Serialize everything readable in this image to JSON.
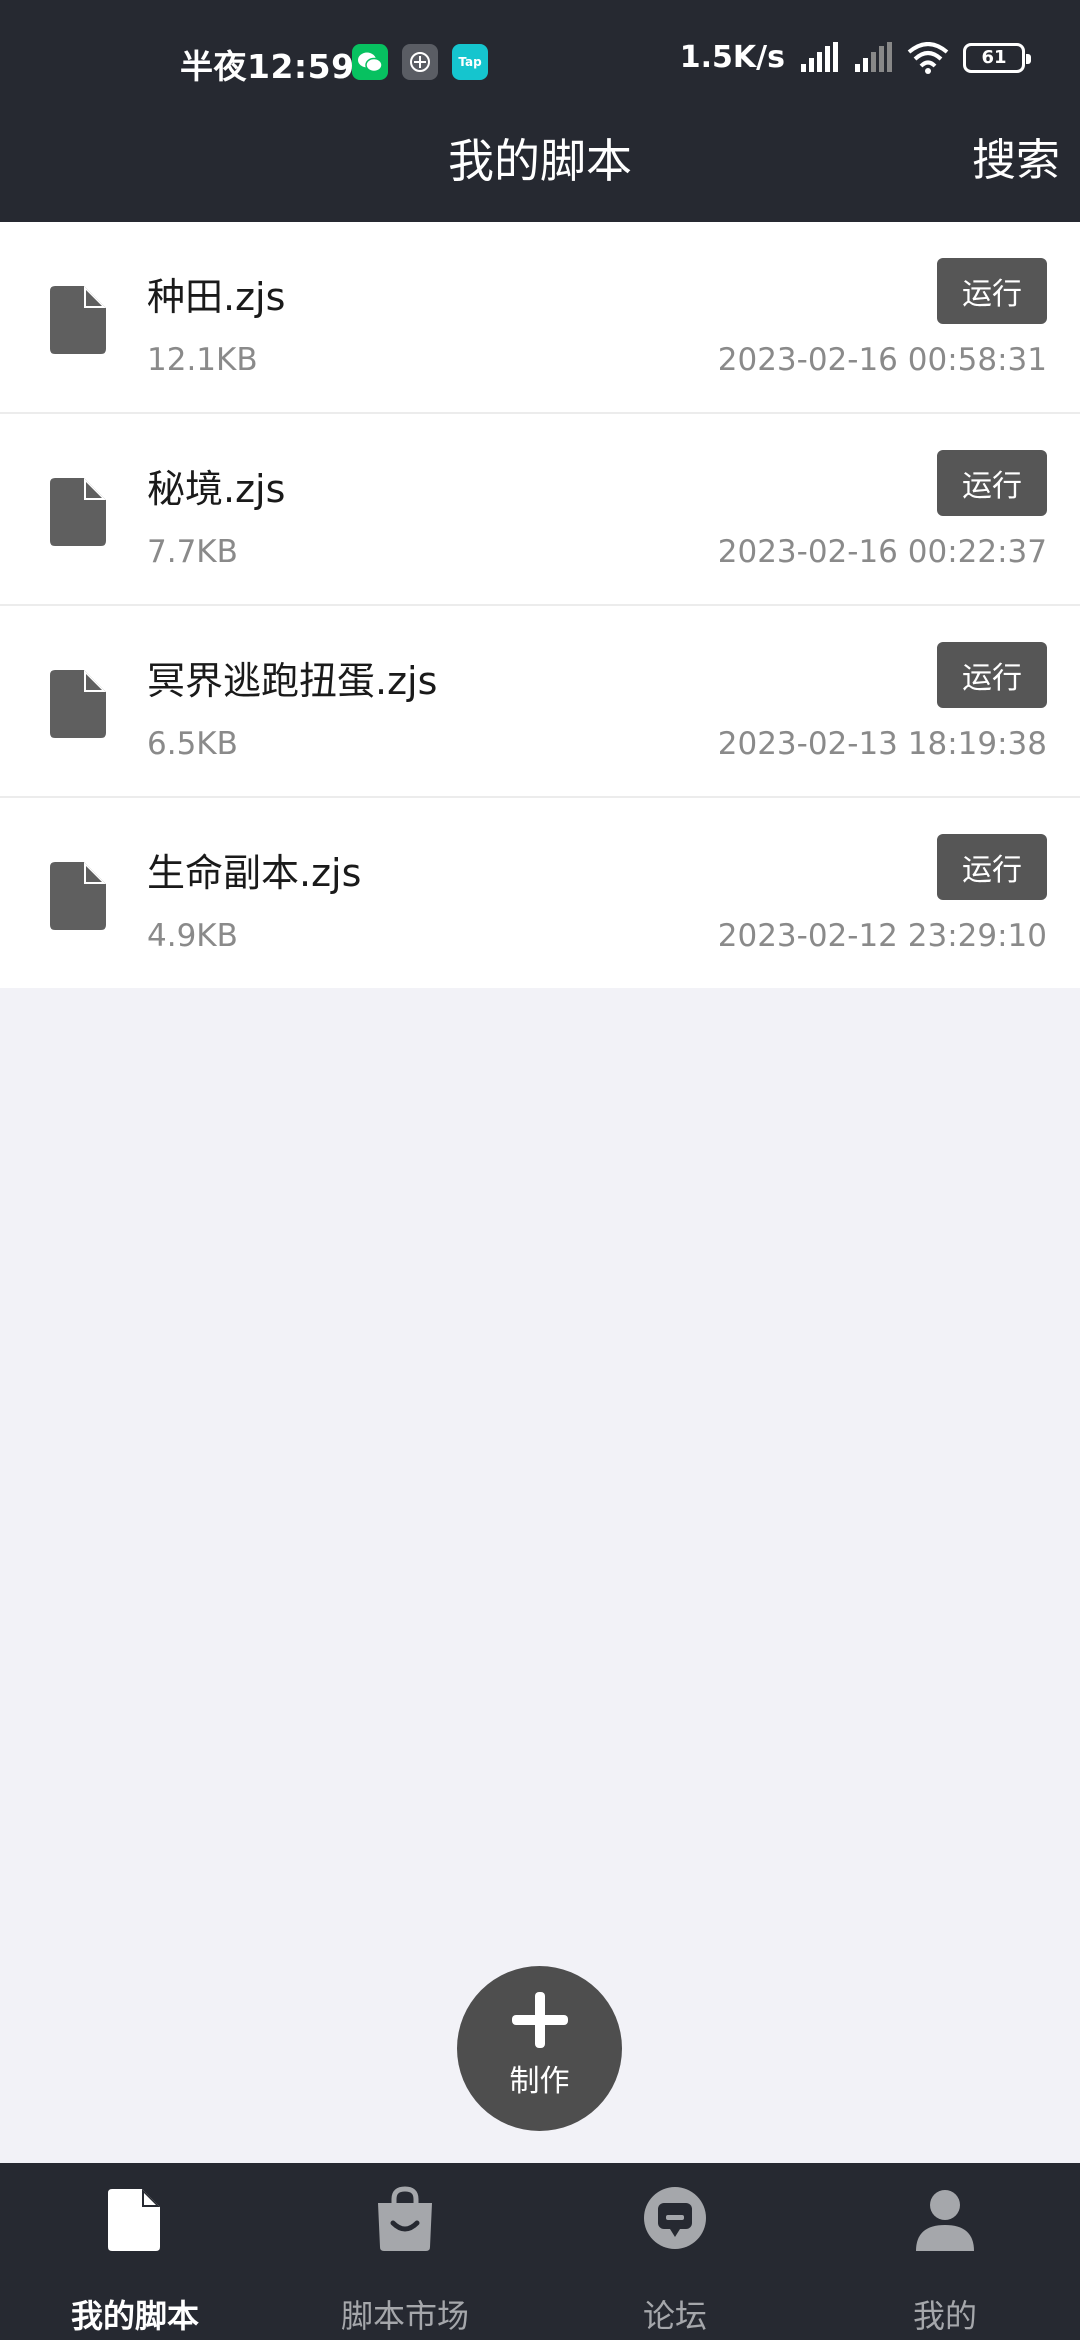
{
  "status_bar": {
    "time": "半夜12:59",
    "net_speed": "1.5K/s",
    "battery": "61",
    "app_icons": [
      "wechat-icon",
      "app-icon",
      "tap-icon"
    ],
    "tap_label": "Tap"
  },
  "header": {
    "title": "我的脚本",
    "search_label": "搜索"
  },
  "scripts": [
    {
      "name": "种田.zjs",
      "size": "12.1KB",
      "date": "2023-02-16 00:58:31",
      "run_label": "运行"
    },
    {
      "name": "秘境.zjs",
      "size": "7.7KB",
      "date": "2023-02-16 00:22:37",
      "run_label": "运行"
    },
    {
      "name": "冥界逃跑扭蛋.zjs",
      "size": "6.5KB",
      "date": "2023-02-13 18:19:38",
      "run_label": "运行"
    },
    {
      "name": "生命副本.zjs",
      "size": "4.9KB",
      "date": "2023-02-12 23:29:10",
      "run_label": "运行"
    }
  ],
  "fab": {
    "label": "制作",
    "icon": "plus-icon"
  },
  "bottom_nav": {
    "items": [
      {
        "label": "我的脚本",
        "icon": "file-icon",
        "active": true
      },
      {
        "label": "脚本市场",
        "icon": "shopping-bag-icon",
        "active": false
      },
      {
        "label": "论坛",
        "icon": "chat-bubble-icon",
        "active": false
      },
      {
        "label": "我的",
        "icon": "person-icon",
        "active": false
      }
    ]
  },
  "colors": {
    "header_bg": "#262931",
    "list_bg": "#ffffff",
    "page_bg": "#f2f2f7",
    "button_bg": "#565656",
    "secondary_text": "#8a8a8a"
  }
}
